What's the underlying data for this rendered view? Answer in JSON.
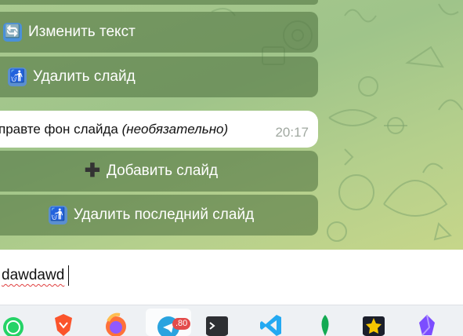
{
  "chat": {
    "buttons": [
      {
        "icon": "refresh-icon",
        "label": "Изменить текст"
      },
      {
        "icon": "trash-icon",
        "label": "Удалить слайд"
      }
    ],
    "message": {
      "text_plain": "правте фон слайда ",
      "text_italic": "(необязательно)",
      "time": "20:17"
    },
    "keyboard": [
      {
        "icon": "plus-icon",
        "label": "Добавить слайд"
      },
      {
        "icon": "trash-icon",
        "label": "Удалить последний слайд"
      }
    ]
  },
  "composer": {
    "value": "dawdawd"
  },
  "taskbar": {
    "apps": [
      {
        "name": "whatsapp-icon"
      },
      {
        "name": "brave-icon"
      },
      {
        "name": "firefox-icon"
      },
      {
        "name": "telegram-icon",
        "badge": "80",
        "active": true
      },
      {
        "name": "terminal-icon"
      },
      {
        "name": "vscode-icon"
      },
      {
        "name": "mongodb-icon"
      },
      {
        "name": "app-star-icon"
      },
      {
        "name": "obsidian-icon"
      }
    ]
  },
  "colors": {
    "wallpaper": "#a9c98e",
    "button_bg": "#4a6e3c",
    "badge": "#e34b4b"
  }
}
